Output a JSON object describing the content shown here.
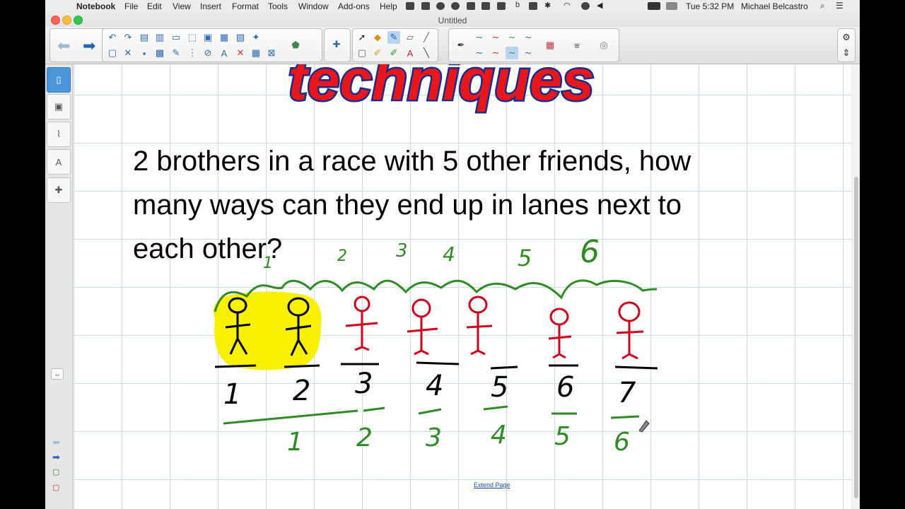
{
  "menubar": {
    "app_name": "Notebook",
    "items": [
      "File",
      "Edit",
      "View",
      "Insert",
      "Format",
      "Tools",
      "Window",
      "Add-ons",
      "Help"
    ],
    "clock": "Tue 5:32 PM",
    "user": "Michael Belcastro"
  },
  "window": {
    "title": "Untitled"
  },
  "banner": {
    "text": "techniques"
  },
  "question": {
    "line1": "2 brothers in a race with 5 other friends, how",
    "line2": "many ways can they end up in lanes next to",
    "line3": "each other?"
  },
  "handwriting": {
    "top_numbers": [
      "1",
      "2",
      "3",
      "4",
      "5",
      "6"
    ],
    "lane_numbers": [
      "1",
      "2",
      "3",
      "4",
      "5",
      "6",
      "7"
    ],
    "bottom_numbers": [
      "1",
      "2",
      "3",
      "4",
      "5",
      "6"
    ]
  },
  "page": {
    "extend_link": "Extend Page"
  },
  "colors": {
    "ink_black": "#000000",
    "ink_red": "#d0021b",
    "ink_green": "#2e8b24",
    "highlight": "#f7f000",
    "accent": "#4a95d6"
  }
}
